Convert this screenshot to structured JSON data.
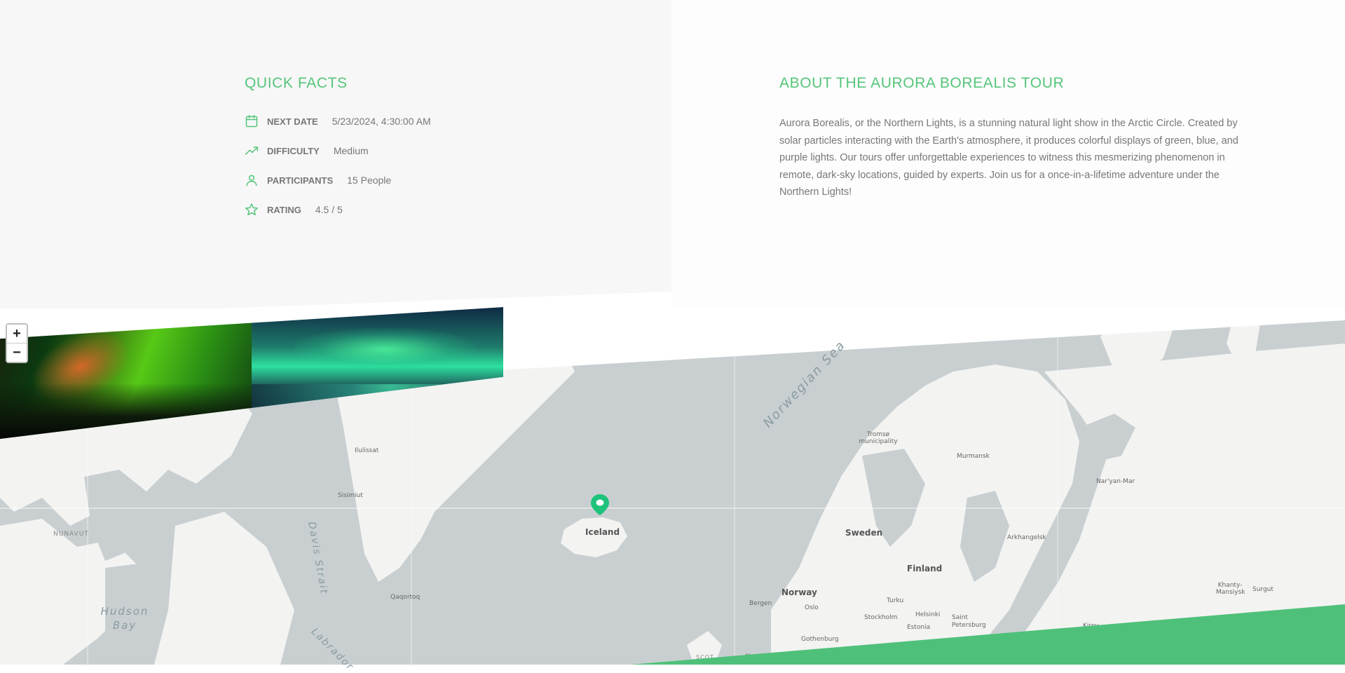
{
  "quick_facts": {
    "title": "Quick Facts",
    "items": [
      {
        "icon": "calendar-icon",
        "label": "Next date",
        "value": "5/23/2024, 4:30:00 AM"
      },
      {
        "icon": "trending-up-icon",
        "label": "Difficulty",
        "value": "Medium"
      },
      {
        "icon": "user-icon",
        "label": "Participants",
        "value": "15 People"
      },
      {
        "icon": "star-icon",
        "label": "Rating",
        "value": "4.5 / 5"
      }
    ]
  },
  "about": {
    "title": "About the Aurora Borealis tour",
    "description": "Aurora Borealis, or the Northern Lights, is a stunning natural light show in the Arctic Circle. Created by solar particles interacting with the Earth's atmosphere, it produces colorful displays of green, blue, and purple lights. Our tours offer unforgettable experiences to witness this mesmerizing phenomenon in remote, dark-sky locations, guided by experts. Join us for a once-in-a-lifetime adventure under the Northern Lights!"
  },
  "map": {
    "zoom_in_label": "+",
    "zoom_out_label": "−",
    "pin_icon": "map-pin-icon",
    "labels": {
      "iceland": "Iceland",
      "sweden": "Sweden",
      "finland": "Finland",
      "norway": "Norway",
      "norwegian_sea": "Norwegian Sea",
      "davis_strait": "Davis Strait",
      "hudson_bay": "Hudson Bay",
      "labrador": "Labrador",
      "nunavut": "NUNAVUT",
      "tromso": "Tromsø municipality",
      "murmansk": "Murmansk",
      "naryan_mar": "Nar'yan-Mar",
      "arkhangelsk": "Arkhangelsk",
      "khanty_mansiysk": "Khanty-Mansiysk",
      "surgut": "Surgut",
      "ilulissat": "Ilulissat",
      "sisimiut": "Sisimiut",
      "qaqortoq": "Qaqortoq",
      "bergen": "Bergen",
      "oslo": "Oslo",
      "gothenburg": "Gothenburg",
      "stockholm": "Stockholm",
      "turku": "Turku",
      "helsinki": "Helsinki",
      "saint_petersburg": "Saint Petersburg",
      "estonia": "Estonia",
      "kirov": "Kirov",
      "scot": "SCOT",
      "north": "North"
    }
  },
  "colors": {
    "accent": "#55c57a",
    "text": "#777777",
    "map_water": "#c9cfd1",
    "map_land": "#f3f3f2"
  }
}
